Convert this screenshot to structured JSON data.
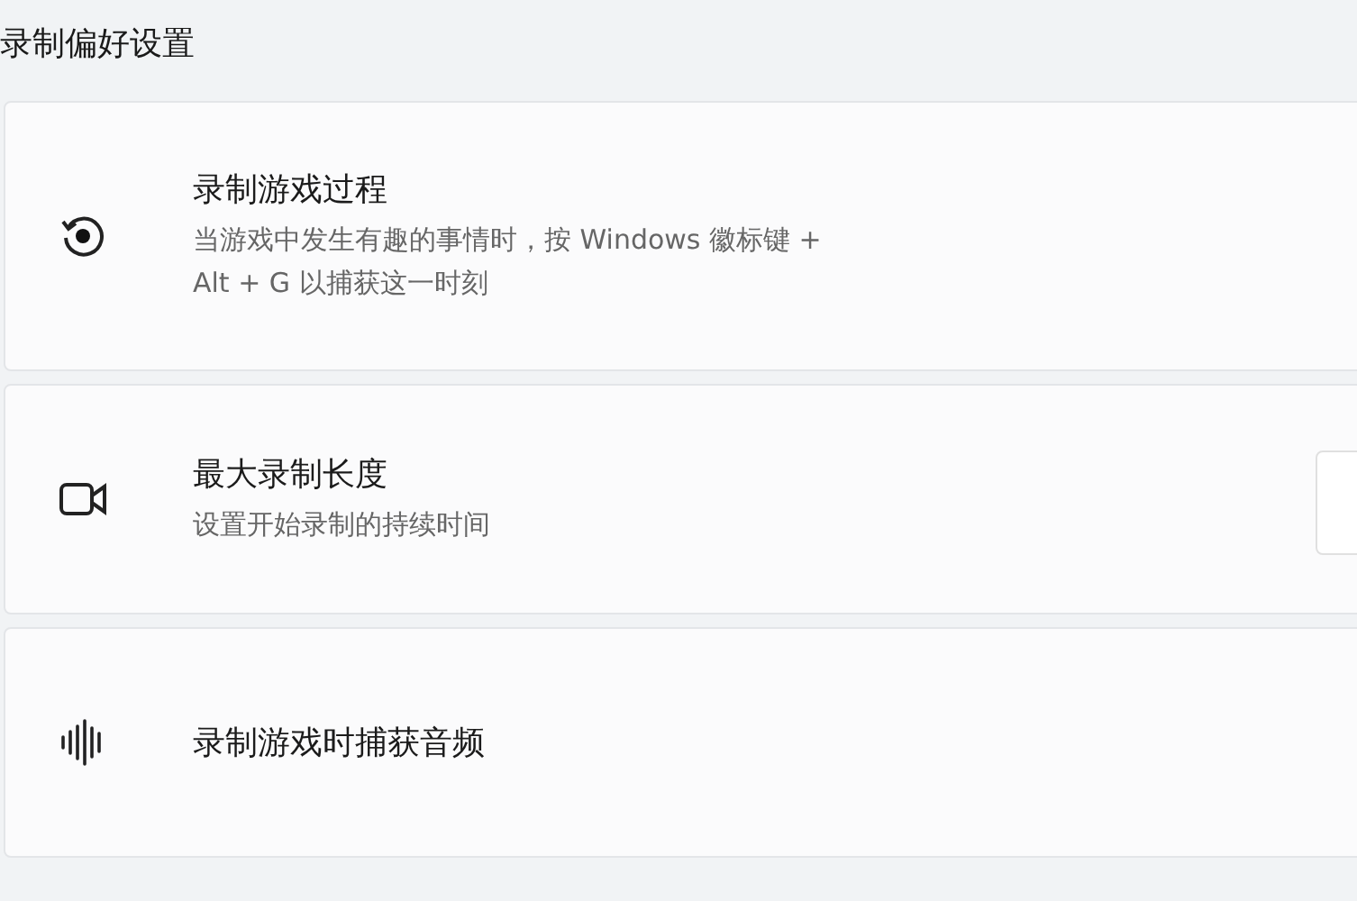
{
  "section_title": "录制偏好设置",
  "settings": [
    {
      "kind": "record",
      "title": "录制游戏过程",
      "description": "当游戏中发生有趣的事情时，按 Windows 徽标键 + Alt + G 以捕获这一时刻"
    },
    {
      "kind": "camera",
      "title": "最大录制长度",
      "description": "设置开始录制的持续时间",
      "dropdown": true
    },
    {
      "kind": "audio",
      "title": "录制游戏时捕获音频"
    }
  ]
}
